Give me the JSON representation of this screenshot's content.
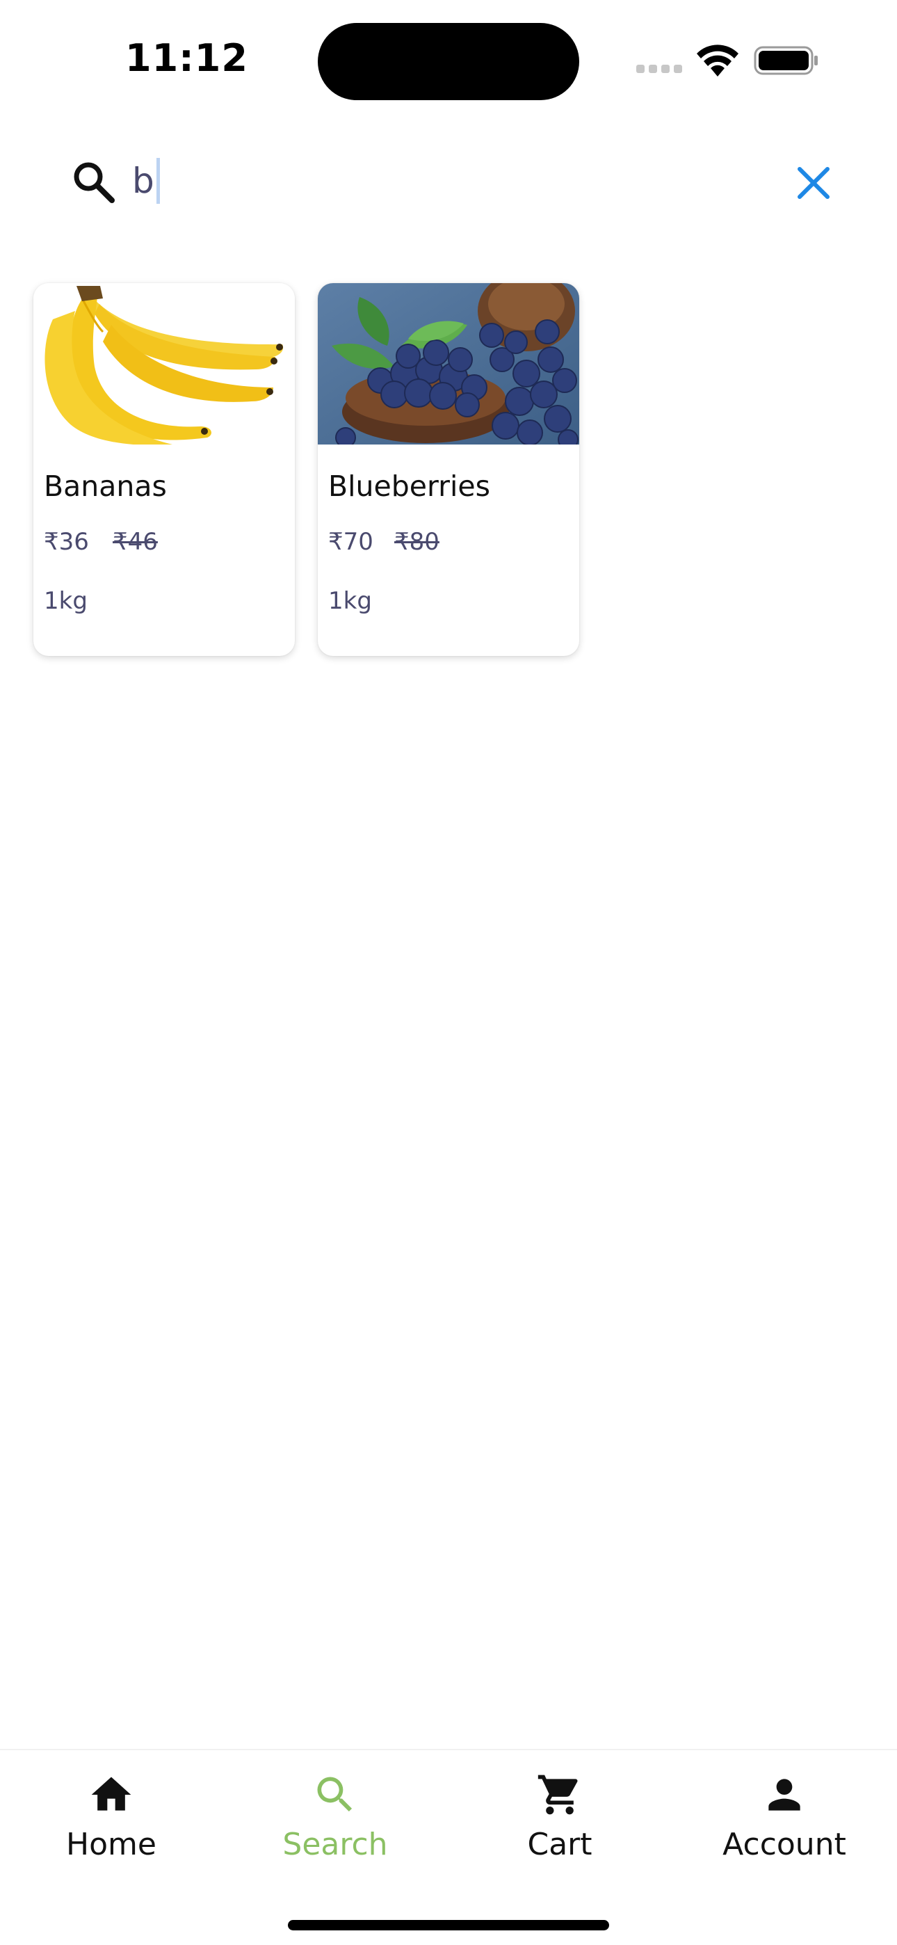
{
  "status_bar": {
    "time": "11:12"
  },
  "search": {
    "query": "b",
    "icon": "search-icon",
    "clear_icon": "close-icon",
    "clear_color": "#1e88e5"
  },
  "products": [
    {
      "name": "Bananas",
      "price": "₹36",
      "mrp": "₹46",
      "unit": "1kg",
      "image": "bananas-image"
    },
    {
      "name": "Blueberries",
      "price": "₹70",
      "mrp": "₹80",
      "unit": "1kg",
      "image": "blueberries-image"
    }
  ],
  "bottom_nav": {
    "active_color": "#8bc063",
    "items": [
      {
        "label": "Home",
        "icon": "home-icon"
      },
      {
        "label": "Search",
        "icon": "search-icon",
        "active": true
      },
      {
        "label": "Cart",
        "icon": "cart-icon"
      },
      {
        "label": "Account",
        "icon": "account-icon"
      }
    ]
  }
}
